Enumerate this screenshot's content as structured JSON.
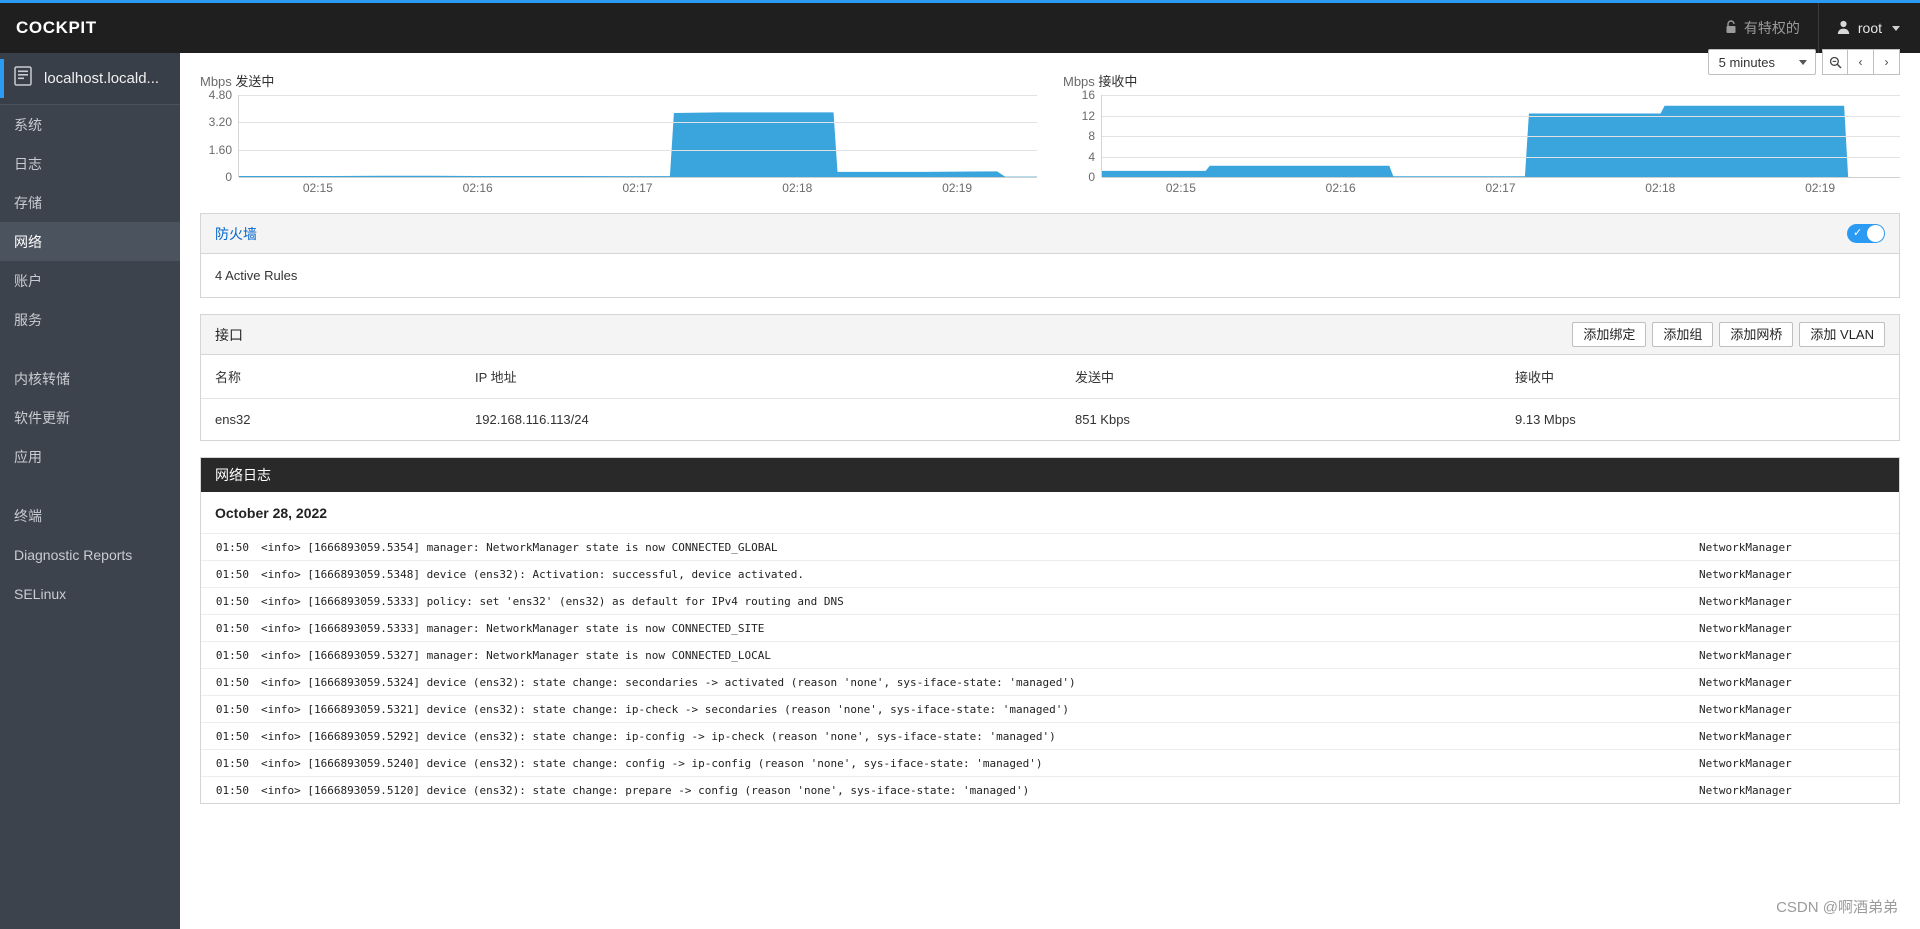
{
  "header": {
    "brand": "COCKPIT",
    "privileged_label": "有特权的",
    "privileged_icon": "lock-icon",
    "user_label": "root",
    "user_icon": "user-icon"
  },
  "sidebar": {
    "host": "localhost.locald...",
    "host_icon": "server-icon",
    "items": [
      {
        "label": "系统",
        "active": false
      },
      {
        "label": "日志",
        "active": false
      },
      {
        "label": "存储",
        "active": false
      },
      {
        "label": "网络",
        "active": true
      },
      {
        "label": "账户",
        "active": false
      },
      {
        "label": "服务",
        "active": false
      },
      {
        "label": "内核转储",
        "active": false
      },
      {
        "label": "软件更新",
        "active": false
      },
      {
        "label": "应用",
        "active": false
      },
      {
        "label": "终端",
        "active": false
      },
      {
        "label": "Diagnostic Reports",
        "active": false
      },
      {
        "label": "SELinux",
        "active": false
      }
    ]
  },
  "toolbar": {
    "range_value": "5 minutes",
    "zoom_icon": "magnifier-icon",
    "prev_icon": "chevron-left-icon",
    "next_icon": "chevron-right-icon"
  },
  "chart_data": [
    {
      "type": "area",
      "title": "发送中",
      "unit": "Mbps",
      "ylabel": "Mbps",
      "xlabel": "",
      "ylim": [
        0,
        4.8
      ],
      "yticks": [
        "4.80",
        "3.20",
        "1.60",
        "0"
      ],
      "ytick_values": [
        4.8,
        3.2,
        1.6,
        0
      ],
      "xticks": [
        "02:15",
        "02:16",
        "02:17",
        "02:18",
        "02:19"
      ],
      "grid": true,
      "color": "#39a5dc",
      "x": [
        0,
        0.06,
        0.12,
        0.18,
        0.24,
        0.3,
        0.36,
        0.42,
        0.48,
        0.54,
        0.545,
        0.6,
        0.66,
        0.72,
        0.745,
        0.75,
        0.8,
        0.86,
        0.92,
        0.95,
        0.96,
        1.0
      ],
      "values": [
        0.06,
        0.06,
        0.06,
        0.07,
        0.07,
        0.06,
        0.06,
        0.06,
        0.05,
        0.05,
        3.75,
        3.78,
        3.78,
        3.78,
        3.78,
        0.3,
        0.3,
        0.3,
        0.32,
        0.33,
        0.02,
        0.02
      ]
    },
    {
      "type": "area",
      "title": "接收中",
      "unit": "Mbps",
      "ylabel": "Mbps",
      "xlabel": "",
      "ylim": [
        0,
        16
      ],
      "yticks": [
        "16",
        "12",
        "8",
        "4",
        "0"
      ],
      "ytick_values": [
        16,
        12,
        8,
        4,
        0
      ],
      "xticks": [
        "02:15",
        "02:16",
        "02:17",
        "02:18",
        "02:19"
      ],
      "grid": true,
      "color": "#39a5dc",
      "x": [
        0,
        0.05,
        0.1,
        0.13,
        0.135,
        0.2,
        0.26,
        0.32,
        0.36,
        0.365,
        0.42,
        0.48,
        0.53,
        0.535,
        0.6,
        0.66,
        0.7,
        0.705,
        0.78,
        0.84,
        0.9,
        0.93,
        0.935,
        1.0
      ],
      "values": [
        1.2,
        1.2,
        1.2,
        1.2,
        2.2,
        2.2,
        2.2,
        2.2,
        2.2,
        0.15,
        0.15,
        0.15,
        0.15,
        12.4,
        12.4,
        12.4,
        12.4,
        13.9,
        13.9,
        13.9,
        13.9,
        13.9,
        0.0,
        0.0
      ]
    }
  ],
  "firewall": {
    "title": "防火墙",
    "status_text": "4 Active Rules",
    "enabled": true,
    "toggle_icon": "check-icon"
  },
  "interfaces": {
    "title": "接口",
    "actions": [
      {
        "label": "添加绑定",
        "name": "add-bond-button"
      },
      {
        "label": "添加组",
        "name": "add-team-button"
      },
      {
        "label": "添加网桥",
        "name": "add-bridge-button"
      },
      {
        "label": "添加 VLAN",
        "name": "add-vlan-button"
      }
    ],
    "columns": [
      "名称",
      "IP 地址",
      "发送中",
      "接收中"
    ],
    "rows": [
      {
        "name": "ens32",
        "ip": "192.168.116.113/24",
        "sending": "851 Kbps",
        "receiving": "9.13 Mbps"
      }
    ]
  },
  "networking_logs": {
    "title": "网络日志",
    "date": "October 28, 2022",
    "entries": [
      {
        "time": "01:50",
        "message": "<info>  [1666893059.5354] manager: NetworkManager state is now CONNECTED_GLOBAL",
        "source": "NetworkManager"
      },
      {
        "time": "01:50",
        "message": "<info>  [1666893059.5348] device (ens32): Activation: successful, device activated.",
        "source": "NetworkManager"
      },
      {
        "time": "01:50",
        "message": "<info>  [1666893059.5333] policy: set 'ens32' (ens32) as default for IPv4 routing and DNS",
        "source": "NetworkManager"
      },
      {
        "time": "01:50",
        "message": "<info>  [1666893059.5333] manager: NetworkManager state is now CONNECTED_SITE",
        "source": "NetworkManager"
      },
      {
        "time": "01:50",
        "message": "<info>  [1666893059.5327] manager: NetworkManager state is now CONNECTED_LOCAL",
        "source": "NetworkManager"
      },
      {
        "time": "01:50",
        "message": "<info>  [1666893059.5324] device (ens32): state change: secondaries -> activated (reason 'none', sys-iface-state: 'managed')",
        "source": "NetworkManager"
      },
      {
        "time": "01:50",
        "message": "<info>  [1666893059.5321] device (ens32): state change: ip-check -> secondaries (reason 'none', sys-iface-state: 'managed')",
        "source": "NetworkManager"
      },
      {
        "time": "01:50",
        "message": "<info>  [1666893059.5292] device (ens32): state change: ip-config -> ip-check (reason 'none', sys-iface-state: 'managed')",
        "source": "NetworkManager"
      },
      {
        "time": "01:50",
        "message": "<info>  [1666893059.5240] device (ens32): state change: config -> ip-config (reason 'none', sys-iface-state: 'managed')",
        "source": "NetworkManager"
      },
      {
        "time": "01:50",
        "message": "<info>  [1666893059.5120] device (ens32): state change: prepare -> config (reason 'none', sys-iface-state: 'managed')",
        "source": "NetworkManager"
      }
    ]
  },
  "watermark": "CSDN @啊酒弟弟"
}
